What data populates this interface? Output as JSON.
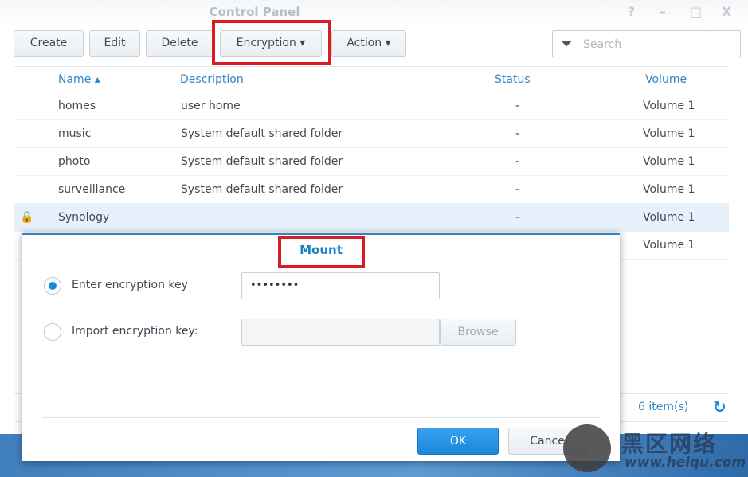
{
  "window": {
    "title": "Control Panel",
    "controls": [
      "?",
      "–",
      "□",
      "X"
    ]
  },
  "toolbar": {
    "create": "Create",
    "edit": "Edit",
    "delete": "Delete",
    "encryption": "Encryption ▾",
    "action": "Action ▾",
    "search_placeholder": "Search"
  },
  "table": {
    "headers": {
      "name": "Name ▴",
      "description": "Description",
      "status": "Status",
      "volume": "Volume"
    },
    "rows": [
      {
        "name": "homes",
        "description": "user home",
        "status": "-",
        "volume": "Volume 1"
      },
      {
        "name": "music",
        "description": "System default shared folder",
        "status": "-",
        "volume": "Volume 1"
      },
      {
        "name": "photo",
        "description": "System default shared folder",
        "status": "-",
        "volume": "Volume 1"
      },
      {
        "name": "surveillance",
        "description": "System default shared folder",
        "status": "-",
        "volume": "Volume 1"
      },
      {
        "name": "Synology",
        "description": "",
        "status": "-",
        "volume": "Volume 1",
        "locked": true
      },
      {
        "name": "",
        "description": "",
        "status": "",
        "volume": "Volume 1"
      }
    ]
  },
  "footer": {
    "count": "6 item(s)"
  },
  "dialog": {
    "title": "Mount",
    "option1": "Enter encryption key",
    "option1_value": "••••••••",
    "option2": "Import encryption key:",
    "browse": "Browse",
    "ok": "OK",
    "cancel": "Cancel",
    "selected": "option1"
  },
  "watermark": {
    "text": "黑区网络",
    "url": "www.heiqu.com"
  },
  "colors": {
    "accent": "#2f86c6",
    "highlight": "#d91c23",
    "ok_button": "#1e8ee0"
  }
}
